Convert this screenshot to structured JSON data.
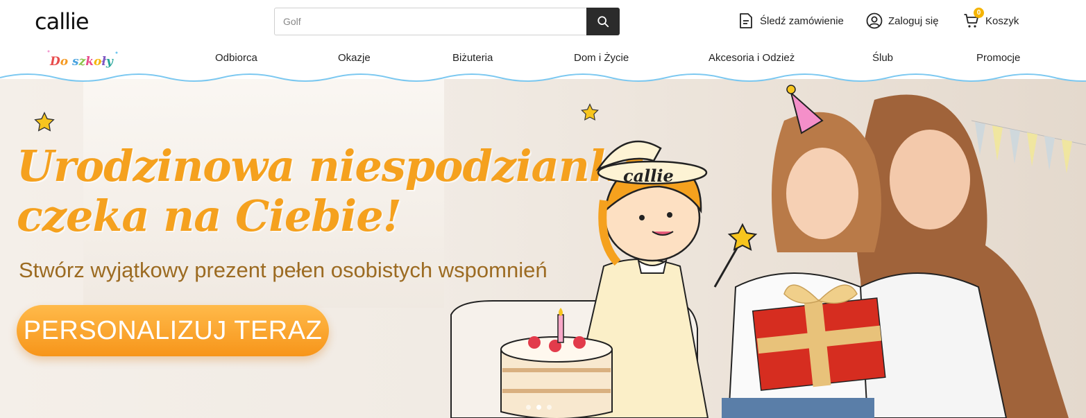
{
  "header": {
    "logo": "callie",
    "search": {
      "placeholder": "Golf",
      "value": ""
    },
    "track_order": "Śledź zamówienie",
    "login": "Zaloguj się",
    "cart": {
      "label": "Koszyk",
      "count": "0"
    }
  },
  "nav": {
    "promo_logo": "Do szkoły",
    "items": [
      {
        "label": "Odbiorca"
      },
      {
        "label": "Okazje"
      },
      {
        "label": "Biżuteria"
      },
      {
        "label": "Dom i Życie"
      },
      {
        "label": "Akcesoria i Odzież"
      },
      {
        "label": "Ślub"
      },
      {
        "label": "Promocje"
      }
    ]
  },
  "hero": {
    "title_line1": "Urodzinowa niespodzianka",
    "title_line2": "czeka na Ciebie!",
    "subtitle": "Stwórz wyjątkowy prezent pełen osobistych wspomnień",
    "cta": "PERSONALIZUJ TERAZ",
    "mascot_label": "callie",
    "slides_total": 3,
    "slide_active": 2
  },
  "colors": {
    "accent_orange": "#f5a11e",
    "subtitle_brown": "#9c6b22",
    "badge_yellow": "#f5b400",
    "search_btn": "#2b2b2b"
  }
}
